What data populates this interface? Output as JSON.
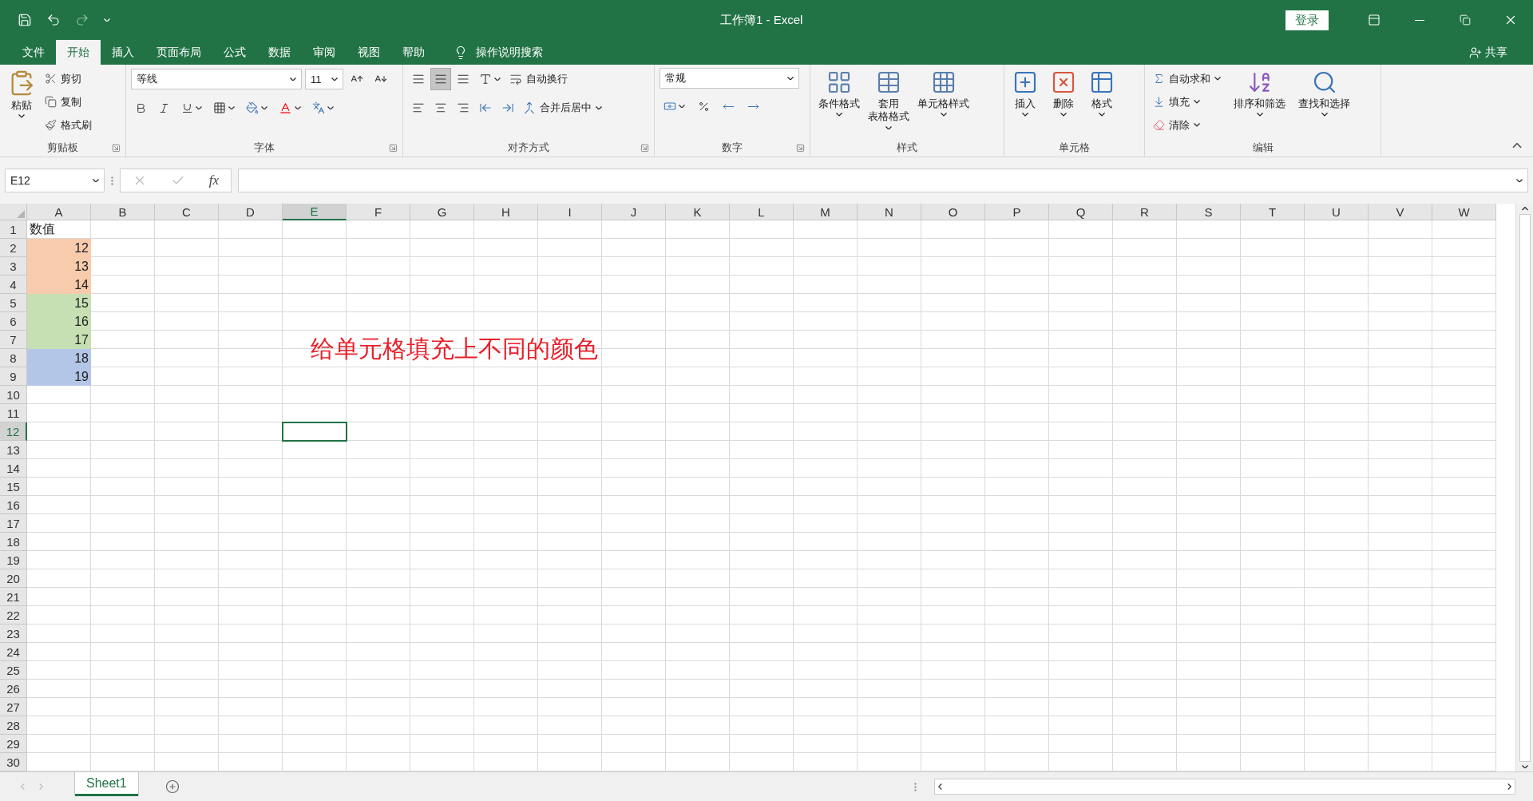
{
  "title_bar": {
    "title": "工作簿1  -  Excel",
    "login": "登录"
  },
  "menu_tabs": [
    {
      "label": "文件",
      "selected": false
    },
    {
      "label": "开始",
      "selected": true
    },
    {
      "label": "插入",
      "selected": false
    },
    {
      "label": "页面布局",
      "selected": false
    },
    {
      "label": "公式",
      "selected": false
    },
    {
      "label": "数据",
      "selected": false
    },
    {
      "label": "审阅",
      "selected": false
    },
    {
      "label": "视图",
      "selected": false
    },
    {
      "label": "帮助",
      "selected": false
    }
  ],
  "tell_me": "操作说明搜索",
  "share": "共享",
  "ribbon": {
    "clipboard": {
      "title": "剪贴板",
      "paste": "粘贴",
      "items": [
        "剪切",
        "复制",
        "格式刷"
      ]
    },
    "font": {
      "title": "字体",
      "font_name": "等线",
      "font_size": "11"
    },
    "alignment": {
      "title": "对齐方式",
      "vertical": [
        {
          "selected": false
        },
        {
          "selected": true
        },
        {
          "selected": false
        }
      ],
      "wrap_text": "自动换行",
      "merge": "合并后居中"
    },
    "number": {
      "title": "数字",
      "format": "常规"
    },
    "styles": {
      "title": "样式",
      "buttons": [
        [
          "条件格式"
        ],
        [
          "套用",
          "表格格式"
        ],
        [
          "单元格样式"
        ]
      ]
    },
    "cells": {
      "title": "单元格",
      "buttons": [
        "插入",
        "删除",
        "格式"
      ]
    },
    "editing": {
      "title": "编辑",
      "items": [
        "自动求和",
        "填充",
        "清除"
      ],
      "buttons": [
        "排序和筛选",
        "查找和选择"
      ]
    }
  },
  "formula_bar": {
    "name_box": "E12",
    "fx": "fx"
  },
  "sheet": {
    "columns": [
      {
        "label": "A",
        "selected": false
      },
      {
        "label": "B",
        "selected": false
      },
      {
        "label": "C",
        "selected": false
      },
      {
        "label": "D",
        "selected": false
      },
      {
        "label": "E",
        "selected": true
      },
      {
        "label": "F",
        "selected": false
      },
      {
        "label": "G",
        "selected": false
      },
      {
        "label": "H",
        "selected": false
      },
      {
        "label": "I",
        "selected": false
      },
      {
        "label": "J",
        "selected": false
      },
      {
        "label": "K",
        "selected": false
      },
      {
        "label": "L",
        "selected": false
      },
      {
        "label": "M",
        "selected": false
      },
      {
        "label": "N",
        "selected": false
      },
      {
        "label": "O",
        "selected": false
      },
      {
        "label": "P",
        "selected": false
      },
      {
        "label": "Q",
        "selected": false
      },
      {
        "label": "R",
        "selected": false
      },
      {
        "label": "S",
        "selected": false
      },
      {
        "label": "T",
        "selected": false
      },
      {
        "label": "U",
        "selected": false
      },
      {
        "label": "V",
        "selected": false
      },
      {
        "label": "W",
        "selected": false
      }
    ],
    "rows": [
      {
        "label": "1",
        "selected": false,
        "cell_a": {
          "value": "数值",
          "kind": "text"
        }
      },
      {
        "label": "2",
        "selected": false,
        "cell_a": {
          "value": "12",
          "kind": "number",
          "color": "#f8cbad"
        }
      },
      {
        "label": "3",
        "selected": false,
        "cell_a": {
          "value": "13",
          "kind": "number",
          "color": "#f8cbad"
        }
      },
      {
        "label": "4",
        "selected": false,
        "cell_a": {
          "value": "14",
          "kind": "number",
          "color": "#f8cbad"
        }
      },
      {
        "label": "5",
        "selected": false,
        "cell_a": {
          "value": "15",
          "kind": "number",
          "color": "#c6e0b4"
        }
      },
      {
        "label": "6",
        "selected": false,
        "cell_a": {
          "value": "16",
          "kind": "number",
          "color": "#c6e0b4"
        }
      },
      {
        "label": "7",
        "selected": false,
        "cell_a": {
          "value": "17",
          "kind": "number",
          "color": "#c6e0b4"
        }
      },
      {
        "label": "8",
        "selected": false,
        "cell_a": {
          "value": "18",
          "kind": "number",
          "color": "#b4c6e7"
        }
      },
      {
        "label": "9",
        "selected": false,
        "cell_a": {
          "value": "19",
          "kind": "number",
          "color": "#b4c6e7"
        }
      },
      {
        "label": "10",
        "selected": false
      },
      {
        "label": "11",
        "selected": false
      },
      {
        "label": "12",
        "selected": true
      },
      {
        "label": "13",
        "selected": false
      },
      {
        "label": "14",
        "selected": false
      },
      {
        "label": "15",
        "selected": false
      },
      {
        "label": "16",
        "selected": false
      },
      {
        "label": "17",
        "selected": false
      },
      {
        "label": "18",
        "selected": false
      },
      {
        "label": "19",
        "selected": false
      },
      {
        "label": "20",
        "selected": false
      },
      {
        "label": "21",
        "selected": false
      },
      {
        "label": "22",
        "selected": false
      },
      {
        "label": "23",
        "selected": false
      },
      {
        "label": "24",
        "selected": false
      },
      {
        "label": "25",
        "selected": false
      },
      {
        "label": "26",
        "selected": false
      },
      {
        "label": "27",
        "selected": false
      },
      {
        "label": "28",
        "selected": false
      },
      {
        "label": "29",
        "selected": false
      },
      {
        "label": "30",
        "selected": false
      }
    ],
    "annotation": "给单元格填充上不同的颜色"
  },
  "sheet_tabs": [
    {
      "label": "Sheet1",
      "selected": true
    }
  ]
}
